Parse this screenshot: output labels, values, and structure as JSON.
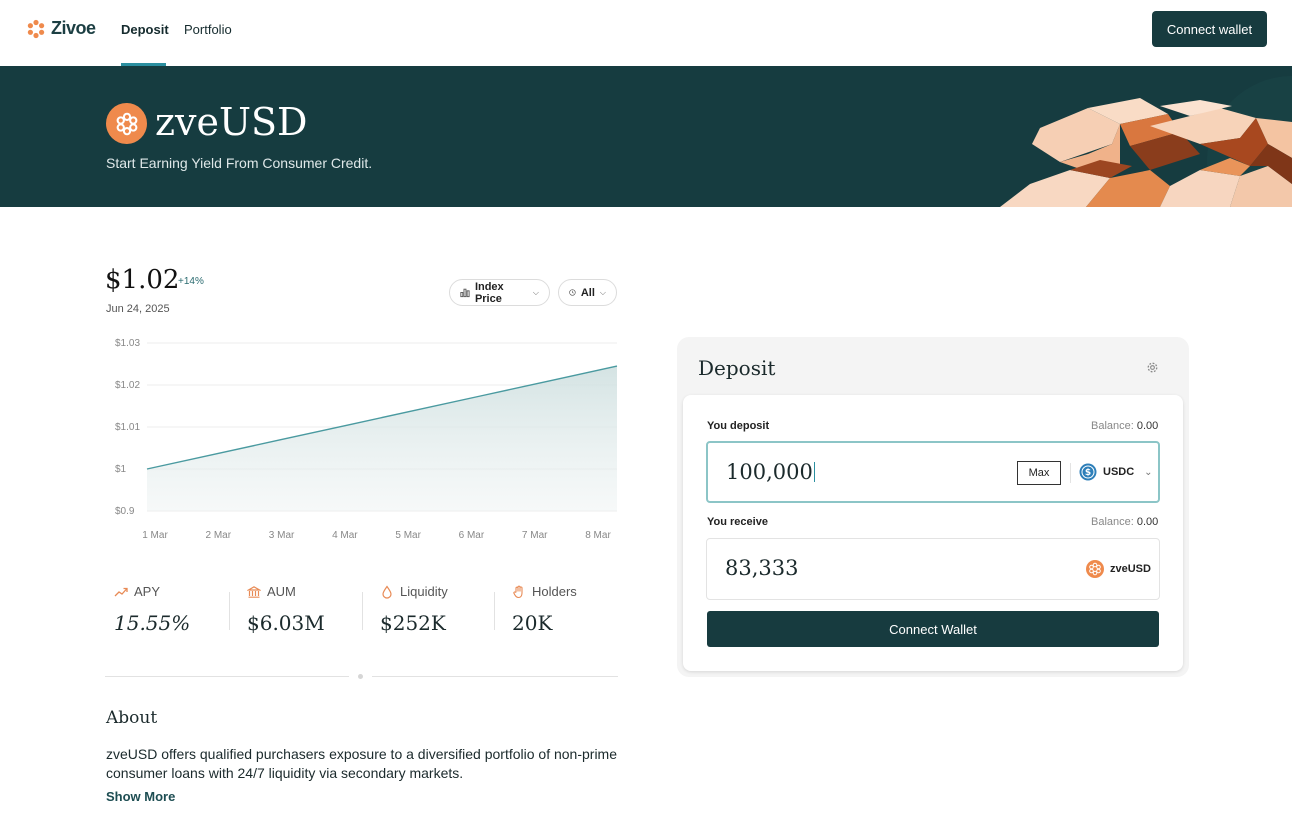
{
  "nav": {
    "brand": "Zivoe",
    "links": [
      "Deposit",
      "Portfolio"
    ],
    "connect_label": "Connect wallet"
  },
  "hero": {
    "title": "zveUSD",
    "subtitle": "Start Earning Yield From Consumer Credit."
  },
  "price": {
    "value": "$1.02",
    "change": "+14%",
    "date": "Jun 24, 2025",
    "metric_selector": "Index Price",
    "range_selector": "All"
  },
  "chart_data": {
    "type": "area",
    "x": [
      "1 Mar",
      "2 Mar",
      "3 Mar",
      "4 Mar",
      "5 Mar",
      "6 Mar",
      "7 Mar",
      "8 Mar"
    ],
    "y_ticks": [
      "$0.9",
      "$1",
      "$1.01",
      "$1.02",
      "$1.03"
    ],
    "series": [
      {
        "values": [
          1.0,
          1.0035,
          1.007,
          1.0105,
          1.014,
          1.0175,
          1.021,
          1.0245
        ]
      }
    ],
    "grid": true,
    "color": "#4a9aa0"
  },
  "stats": [
    {
      "label": "APY",
      "value": "15.55%",
      "icon": "trend-up-icon"
    },
    {
      "label": "AUM",
      "value": "$6.03M",
      "icon": "bank-icon"
    },
    {
      "label": "Liquidity",
      "value": "$252K",
      "icon": "drop-icon"
    },
    {
      "label": "Holders",
      "value": "20K",
      "icon": "hand-icon"
    }
  ],
  "about": {
    "title": "About",
    "text": "zveUSD offers qualified purchasers exposure to a diversified portfolio of non-prime consumer loans with 24/7 liquidity via secondary markets.",
    "show_more": "Show More"
  },
  "deposit": {
    "title": "Deposit",
    "you_deposit_label": "You deposit",
    "deposit_balance_label": "Balance:",
    "deposit_balance_value": "0.00",
    "deposit_amount": "100,000",
    "max_label": "Max",
    "deposit_token": "USDC",
    "you_receive_label": "You receive",
    "receive_balance_label": "Balance:",
    "receive_balance_value": "0.00",
    "receive_amount": "83,333",
    "receive_token": "zveUSD",
    "connect_label": "Connect Wallet"
  },
  "colors": {
    "brand_dark": "#163c40",
    "brand_orange": "#ef8a4c",
    "accent_teal": "#2b8fa0"
  }
}
